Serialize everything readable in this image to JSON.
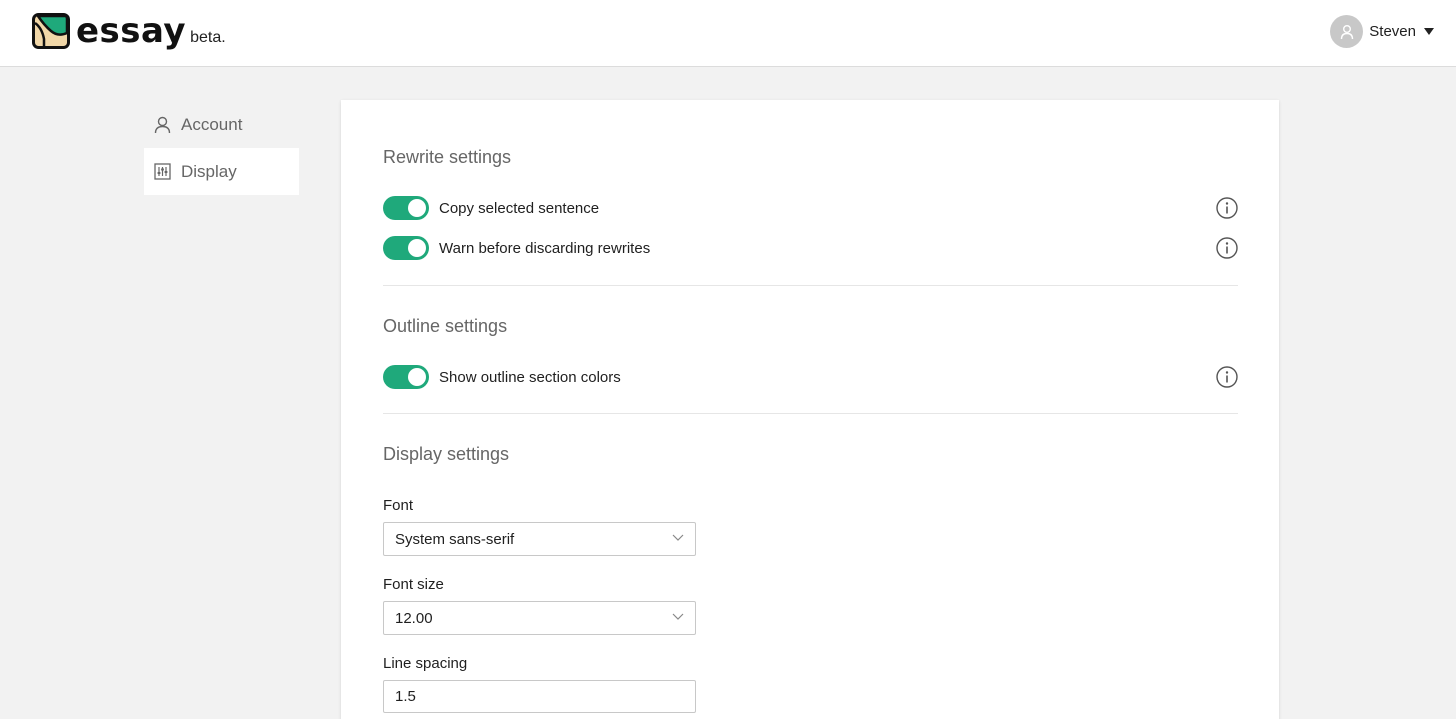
{
  "brand": {
    "name": "essay",
    "tag": "beta.",
    "icon": "essay-logo-icon"
  },
  "user": {
    "name": "Steven",
    "icon": "user-avatar-icon"
  },
  "sidebar": {
    "items": [
      {
        "label": "Account",
        "icon": "person-icon",
        "active": false
      },
      {
        "label": "Display",
        "icon": "sliders-icon",
        "active": true
      }
    ]
  },
  "rewrite": {
    "title": "Rewrite settings",
    "settings": [
      {
        "label": "Copy selected sentence",
        "enabled": true
      },
      {
        "label": "Warn before discarding rewrites",
        "enabled": true
      }
    ]
  },
  "outline": {
    "title": "Outline settings",
    "settings": [
      {
        "label": "Show outline section colors",
        "enabled": true
      }
    ]
  },
  "display": {
    "title": "Display settings",
    "font": {
      "label": "Font",
      "value": "System sans-serif"
    },
    "font_size": {
      "label": "Font size",
      "value": "12.00"
    },
    "line_spacing": {
      "label": "Line spacing",
      "value": "1.5"
    }
  },
  "colors": {
    "toggle_on": "#1fa97b",
    "logo_green": "#1fa97b",
    "logo_tan": "#f1d7a8"
  }
}
